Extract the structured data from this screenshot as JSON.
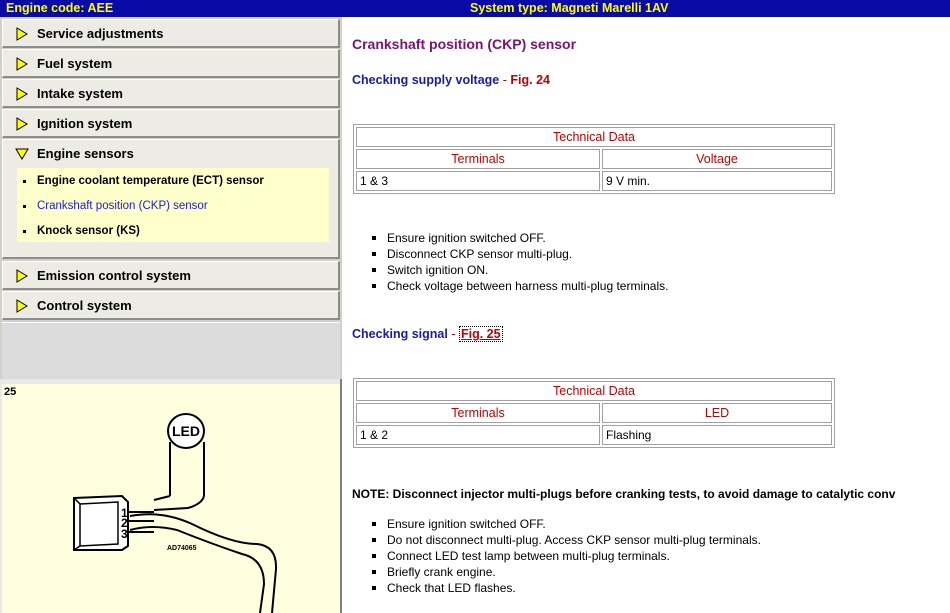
{
  "topbar": {
    "engine_code": "Engine code: AEE",
    "system_type": "System type: Magneti Marelli 1AV"
  },
  "sidebar": {
    "items": [
      {
        "label": "Service adjustments"
      },
      {
        "label": "Fuel system"
      },
      {
        "label": "Intake system"
      },
      {
        "label": "Ignition system"
      },
      {
        "label": "Engine sensors"
      },
      {
        "label": "Emission control system"
      },
      {
        "label": "Control system"
      }
    ],
    "subitems": [
      {
        "label": "Engine coolant temperature (ECT) sensor"
      },
      {
        "label": "Crankshaft position (CKP) sensor"
      },
      {
        "label": "Knock sensor (KS)"
      }
    ]
  },
  "figure": {
    "number": "25",
    "led_label": "LED",
    "pin1": "1",
    "pin2": "2",
    "pin3": "3",
    "ref": "AD74065"
  },
  "content": {
    "title": "Crankshaft position (CKP) sensor",
    "section1": {
      "label": "Checking supply voltage",
      "dash": " - ",
      "fig": "Fig. 24",
      "table": {
        "caption": "Technical Data",
        "col1": "Terminals",
        "col2": "Voltage",
        "row1": {
          "terminals": "1 & 3",
          "value": "9 V min."
        }
      },
      "steps": [
        "Ensure ignition switched OFF.",
        "Disconnect CKP sensor multi-plug.",
        "Switch ignition ON.",
        "Check voltage between harness multi-plug terminals."
      ]
    },
    "section2": {
      "label": "Checking signal",
      "dash": " - ",
      "fig": "Fig. 25",
      "table": {
        "caption": "Technical Data",
        "col1": "Terminals",
        "col2": "LED",
        "row1": {
          "terminals": "1 & 2",
          "value": "Flashing"
        }
      },
      "note": "NOTE: Disconnect injector multi-plugs before cranking tests, to avoid damage to catalytic conv",
      "steps": [
        "Ensure ignition switched OFF.",
        "Do not disconnect multi-plug. Access CKP sensor multi-plug terminals.",
        "Connect LED test lamp between multi-plug terminals.",
        "Briefly crank engine.",
        "Check that LED flashes."
      ]
    }
  },
  "colors": {
    "topbar_bg": "#0a0aa6",
    "topbar_text": "#ffff00",
    "title": "#80107a",
    "section": "#1a1aaa",
    "accent_red": "#c00000",
    "submenu_bg": "#ffffcc",
    "arrow_fill": "#ffff00"
  }
}
